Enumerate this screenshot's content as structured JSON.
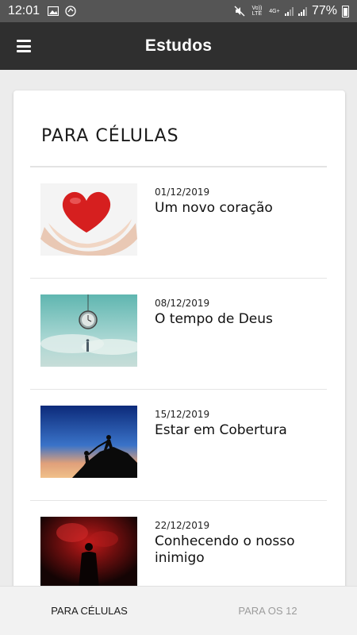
{
  "status_bar": {
    "time": "12:01",
    "battery": "77%",
    "network_volte": "Vo)) LTE",
    "network_4g": "4G+",
    "icons": [
      "image-icon",
      "sync-icon",
      "mute-icon",
      "signal-icon",
      "battery-icon"
    ]
  },
  "app_bar": {
    "title": "Estudos",
    "menu_icon": "hamburger-menu-icon"
  },
  "section": {
    "title": "PARA CÉLULAS"
  },
  "items": [
    {
      "date": "01/12/2019",
      "title": "Um novo coração",
      "image": "heart-in-hands"
    },
    {
      "date": "08/12/2019",
      "title": "O tempo de Deus",
      "image": "clock-over-person"
    },
    {
      "date": "15/12/2019",
      "title": "Estar em Cobertura",
      "image": "climbers-silhouette"
    },
    {
      "date": "22/12/2019",
      "title": "Conhecendo o nosso inimigo",
      "image": "figure-in-red-smoke"
    }
  ],
  "bottom_nav": {
    "tabs": [
      {
        "label": "PARA CÉLULAS",
        "active": true
      },
      {
        "label": "PARA OS 12",
        "active": false
      }
    ]
  },
  "colors": {
    "status_bar": "#555555",
    "app_bar": "#2f2f2f",
    "background": "#ececec",
    "card": "#ffffff",
    "bottom_nav": "#f2f2f2",
    "active_tab": "#1a1a1a",
    "inactive_tab": "#9c9c9c"
  }
}
